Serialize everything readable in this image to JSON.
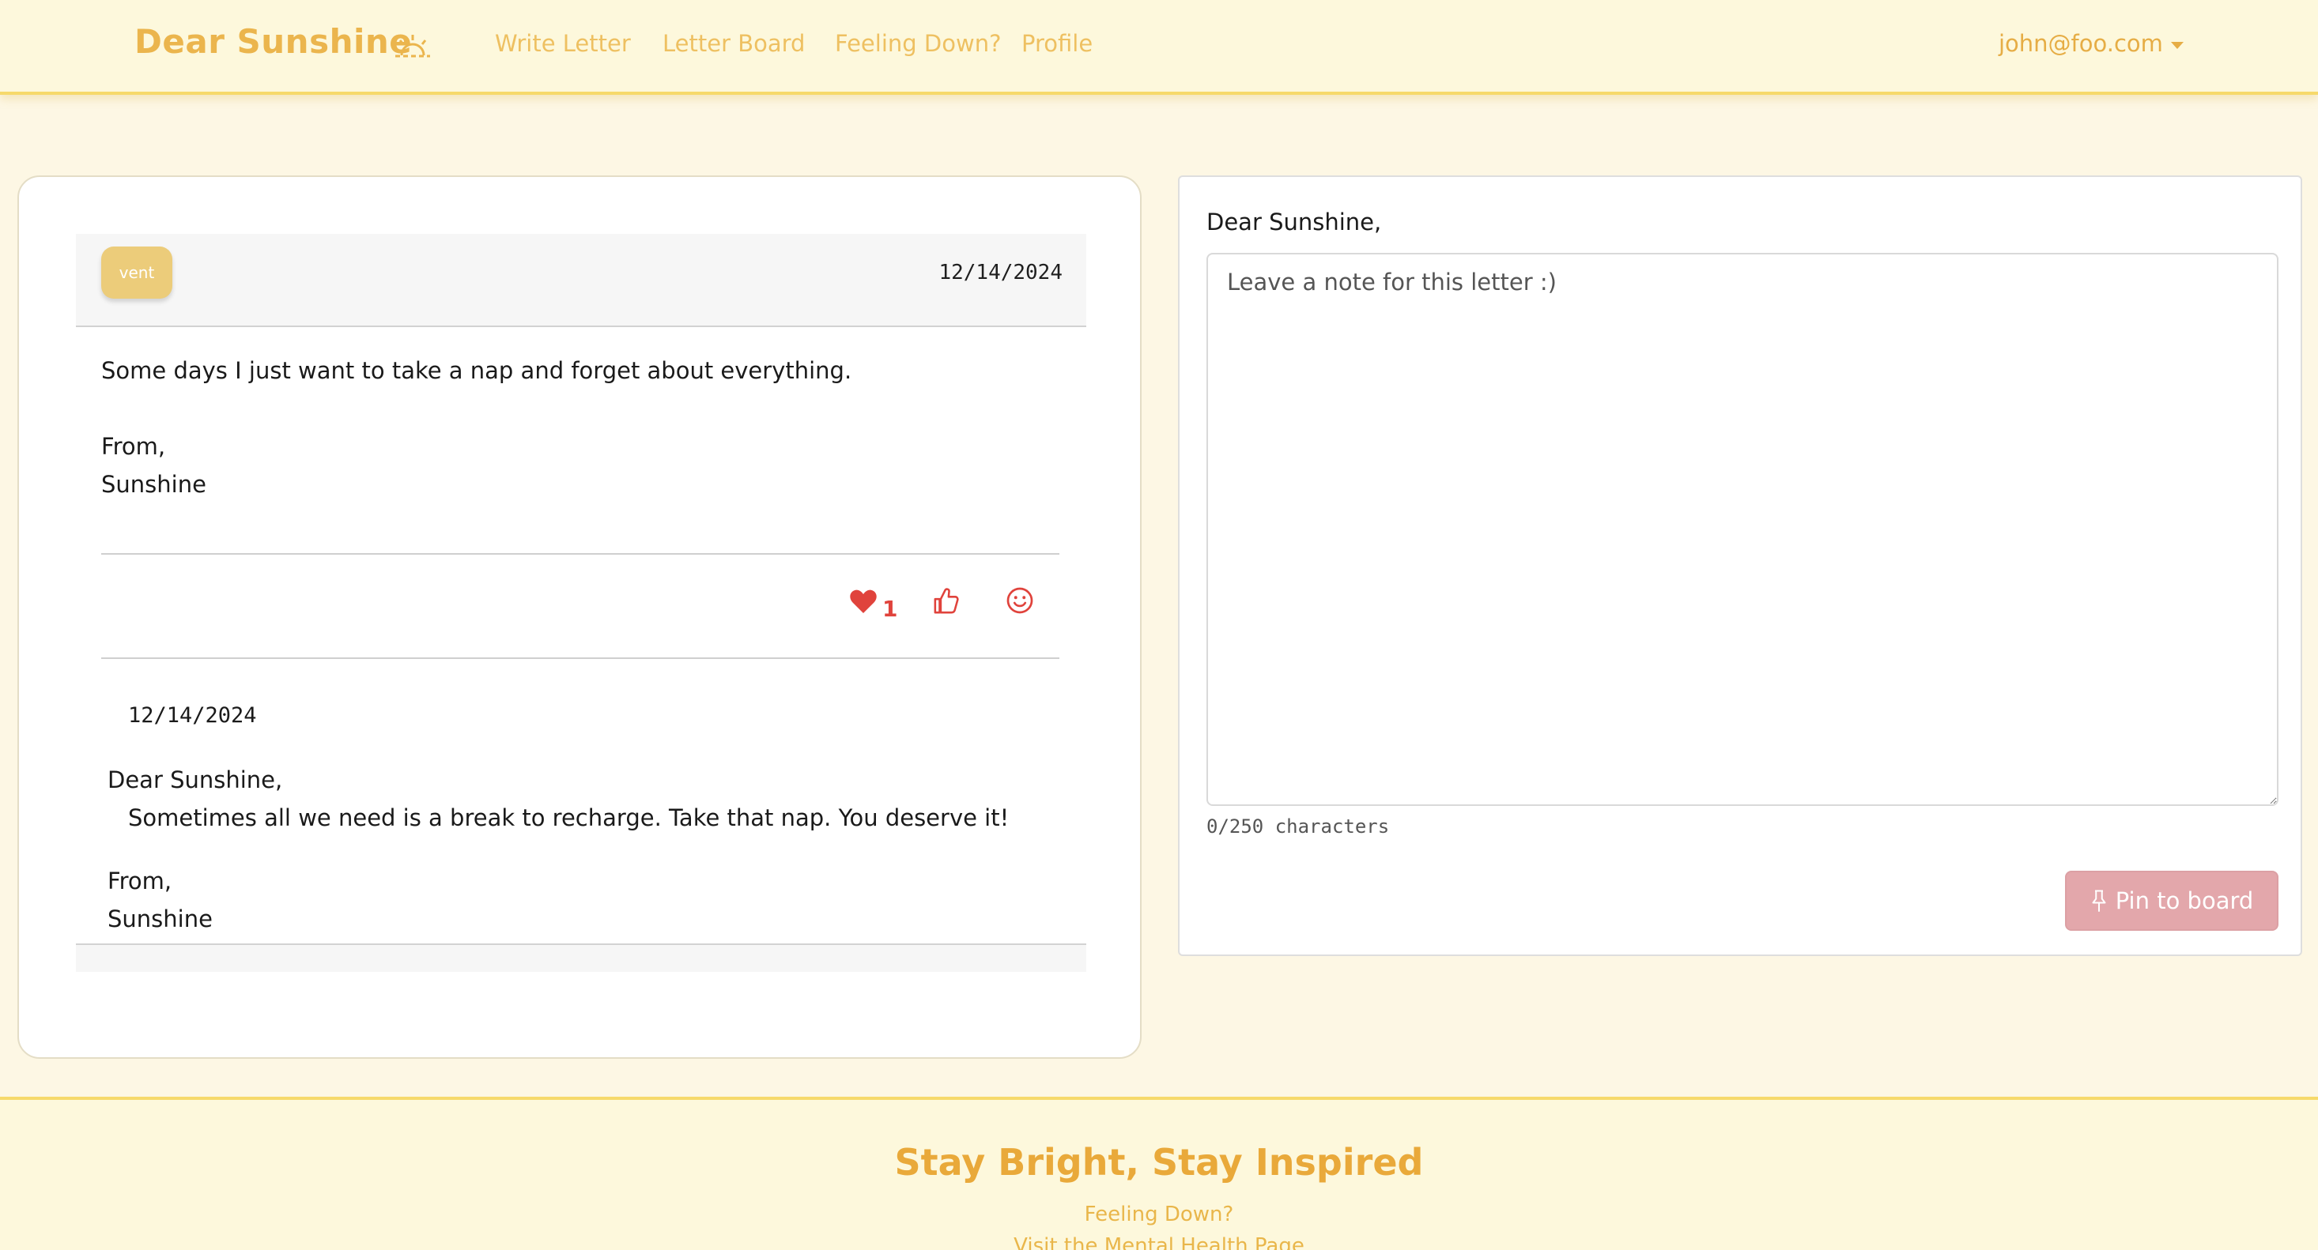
{
  "navbar": {
    "brand": "Dear Sunshine",
    "brand_icon": "sunrise-icon",
    "links": [
      "Write Letter",
      "Letter Board",
      "Feeling Down?",
      "Profile"
    ],
    "user_email": "john@foo.com"
  },
  "letter": {
    "tag": "vent",
    "date": "12/14/2024",
    "body": "Some days I just want to take a nap and forget about everything.",
    "closing": "From,",
    "signature": "Sunshine",
    "reactions": {
      "heart_count": "1",
      "heart_icon": "heart-icon",
      "thumbs_icon": "thumbs-up-icon",
      "smile_icon": "smile-icon"
    },
    "reply": {
      "date": "12/14/2024",
      "salutation": "Dear Sunshine,",
      "body": "Sometimes all we need is a break to recharge. Take that nap. You deserve it!",
      "closing": "From,",
      "signature": "Sunshine"
    }
  },
  "note_form": {
    "salutation": "Dear Sunshine,",
    "placeholder": "Leave a note for this letter :)",
    "char_count": "0/250 characters",
    "submit_label": "Pin to board",
    "submit_icon": "pin-icon"
  },
  "footer": {
    "title": "Stay Bright, Stay Inspired",
    "link_1": "Feeling Down?",
    "link_2": "Visit the Mental Health Page"
  },
  "colors": {
    "brand": "#ebb54d",
    "background": "#fdf7e4",
    "navbar_bg": "#fdf8dc",
    "accent_border": "#f6d96b",
    "reaction_red": "#e0433c",
    "pin_button": "#e3a7ab",
    "tag_badge": "#eccc7a"
  }
}
